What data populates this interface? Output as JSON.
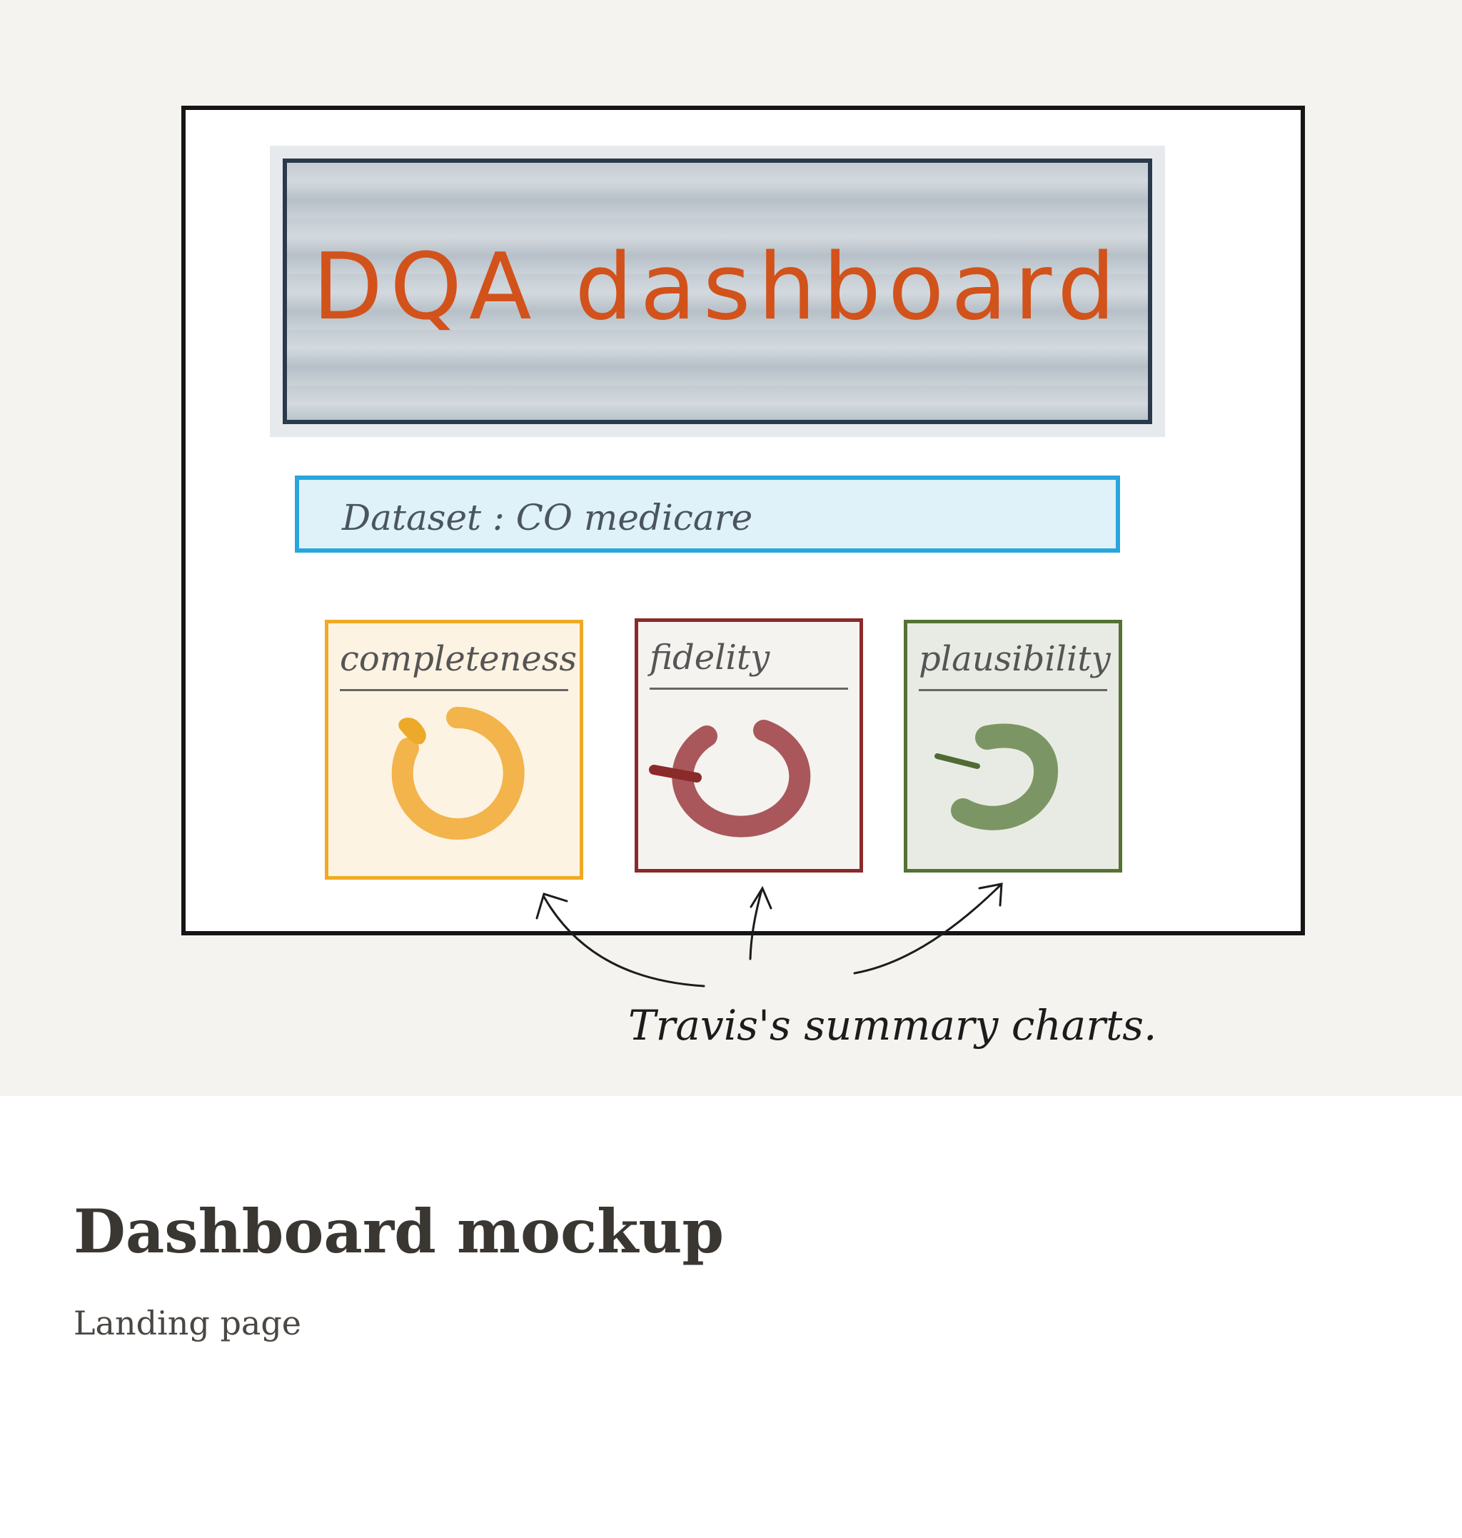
{
  "banner": {
    "title": "DQA dashboard"
  },
  "dataset": {
    "label": "Dataset : CO medicare"
  },
  "cards": [
    {
      "id": "completeness",
      "label": "completeness",
      "color": "#efaa24",
      "icon": "donut-gauge-icon"
    },
    {
      "id": "fidelity",
      "label": "fidelity",
      "color": "#8b2a2a",
      "icon": "donut-gauge-icon"
    },
    {
      "id": "plausibility",
      "label": "plausibility",
      "color": "#557235",
      "icon": "donut-gauge-icon"
    }
  ],
  "annotation": {
    "text": "Travis's summary charts."
  },
  "caption": {
    "title": "Dashboard mockup",
    "subtitle": "Landing page"
  }
}
